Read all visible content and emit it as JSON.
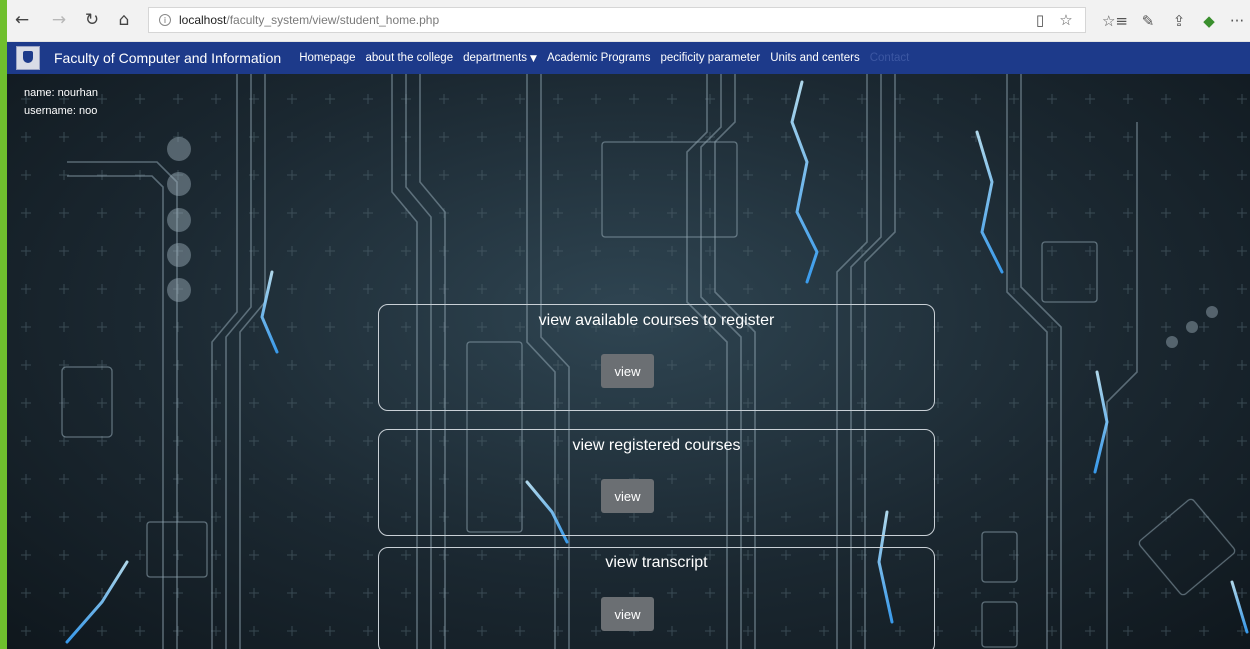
{
  "browser": {
    "url_host": "localhost",
    "url_path": "/faculty_system/view/student_home.php",
    "back_icon": "←",
    "forward_icon": "→",
    "refresh_icon": "↻",
    "home_icon": "⌂",
    "info_icon": "i",
    "reading_view_icon": "▯",
    "favorite_icon": "☆",
    "favorites_hub_icon": "☆≡",
    "notes_icon": "✎",
    "share_icon": "⇪",
    "extension_icon": "◆",
    "more_icon": "···"
  },
  "site": {
    "brand": "Faculty of Computer and Information",
    "nav": [
      {
        "label": "Homepage"
      },
      {
        "label": "about the college"
      },
      {
        "label": "departments"
      },
      {
        "label": "Academic Programs"
      },
      {
        "label": "pecificity parameter"
      },
      {
        "label": "Units and centers"
      },
      {
        "label": "Contact"
      }
    ],
    "dropdown_caret": "▼"
  },
  "user": {
    "name_line": "name: nourhan",
    "username_line": "username: noo"
  },
  "cards": [
    {
      "title": "view available courses to register",
      "button": "view"
    },
    {
      "title": "view registered courses",
      "button": "view"
    },
    {
      "title": "view transcript",
      "button": "view"
    }
  ],
  "colors": {
    "navbar": "#1d3a8a",
    "button": "#6b6f73",
    "accent_strip": "#6fbf2e"
  }
}
